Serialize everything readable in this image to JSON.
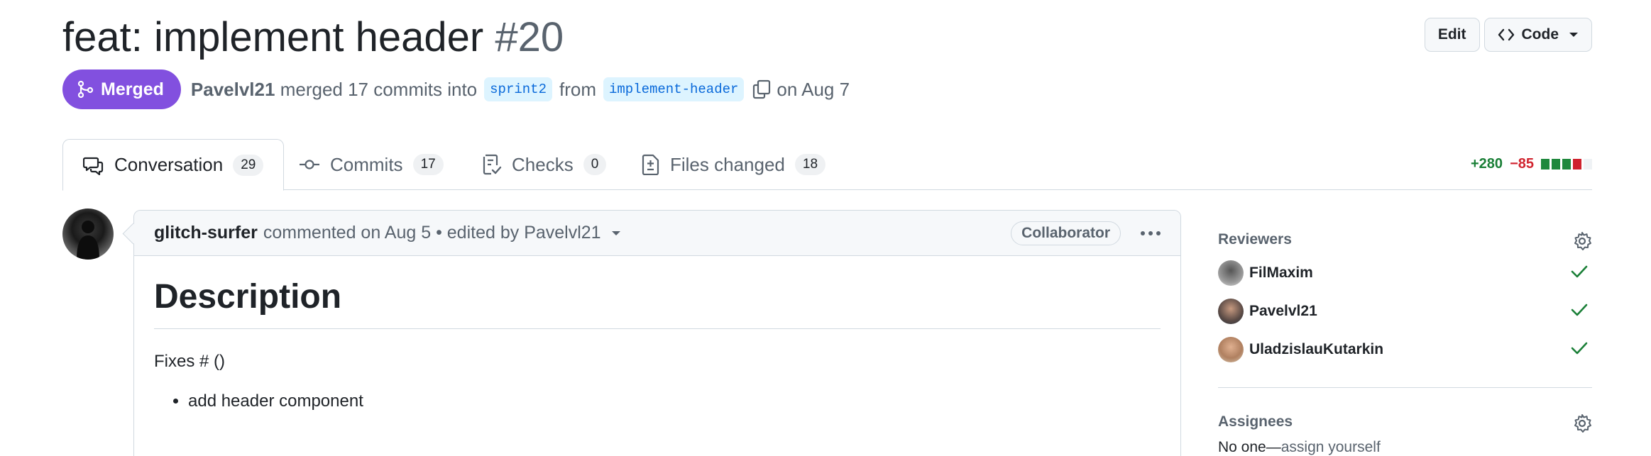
{
  "pr": {
    "title": "feat: implement header",
    "number": "#20",
    "state": "Merged",
    "author": "Pavelvl21",
    "merge_text": "merged 17 commits into",
    "base_branch": "sprint2",
    "from_text": "from",
    "head_branch": "implement-header",
    "date_text": "on Aug 7"
  },
  "header_actions": {
    "edit_label": "Edit",
    "code_label": "Code"
  },
  "tabs": [
    {
      "label": "Conversation",
      "count": "29",
      "icon": "comment-discussion-icon"
    },
    {
      "label": "Commits",
      "count": "17",
      "icon": "git-commit-icon"
    },
    {
      "label": "Checks",
      "count": "0",
      "icon": "checklist-icon"
    },
    {
      "label": "Files changed",
      "count": "18",
      "icon": "file-diff-icon"
    }
  ],
  "diffstat": {
    "additions": "+280",
    "deletions": "−85",
    "blocks": [
      "#1f883d",
      "#1f883d",
      "#1f883d",
      "#cf222e",
      "#eff2f5"
    ]
  },
  "comment": {
    "author": "glitch-surfer",
    "meta": "commented on Aug 5 •",
    "edited": "edited by Pavelvl21",
    "role": "Collaborator",
    "heading": "Description",
    "paragraph": "Fixes # ()",
    "bullets": [
      "add header component"
    ]
  },
  "sidebar": {
    "reviewers_title": "Reviewers",
    "reviewers": [
      {
        "name": "FilMaxim",
        "status": "approved"
      },
      {
        "name": "Pavelvl21",
        "status": "approved"
      },
      {
        "name": "UladzislauKutarkin",
        "status": "approved"
      }
    ],
    "assignees_title": "Assignees",
    "assignees_empty": "No one—",
    "assignees_link": "assign yourself"
  },
  "colors": {
    "merged": "#8250df",
    "accent": "#0969da",
    "success": "#1a7f37",
    "danger": "#d1242f"
  }
}
